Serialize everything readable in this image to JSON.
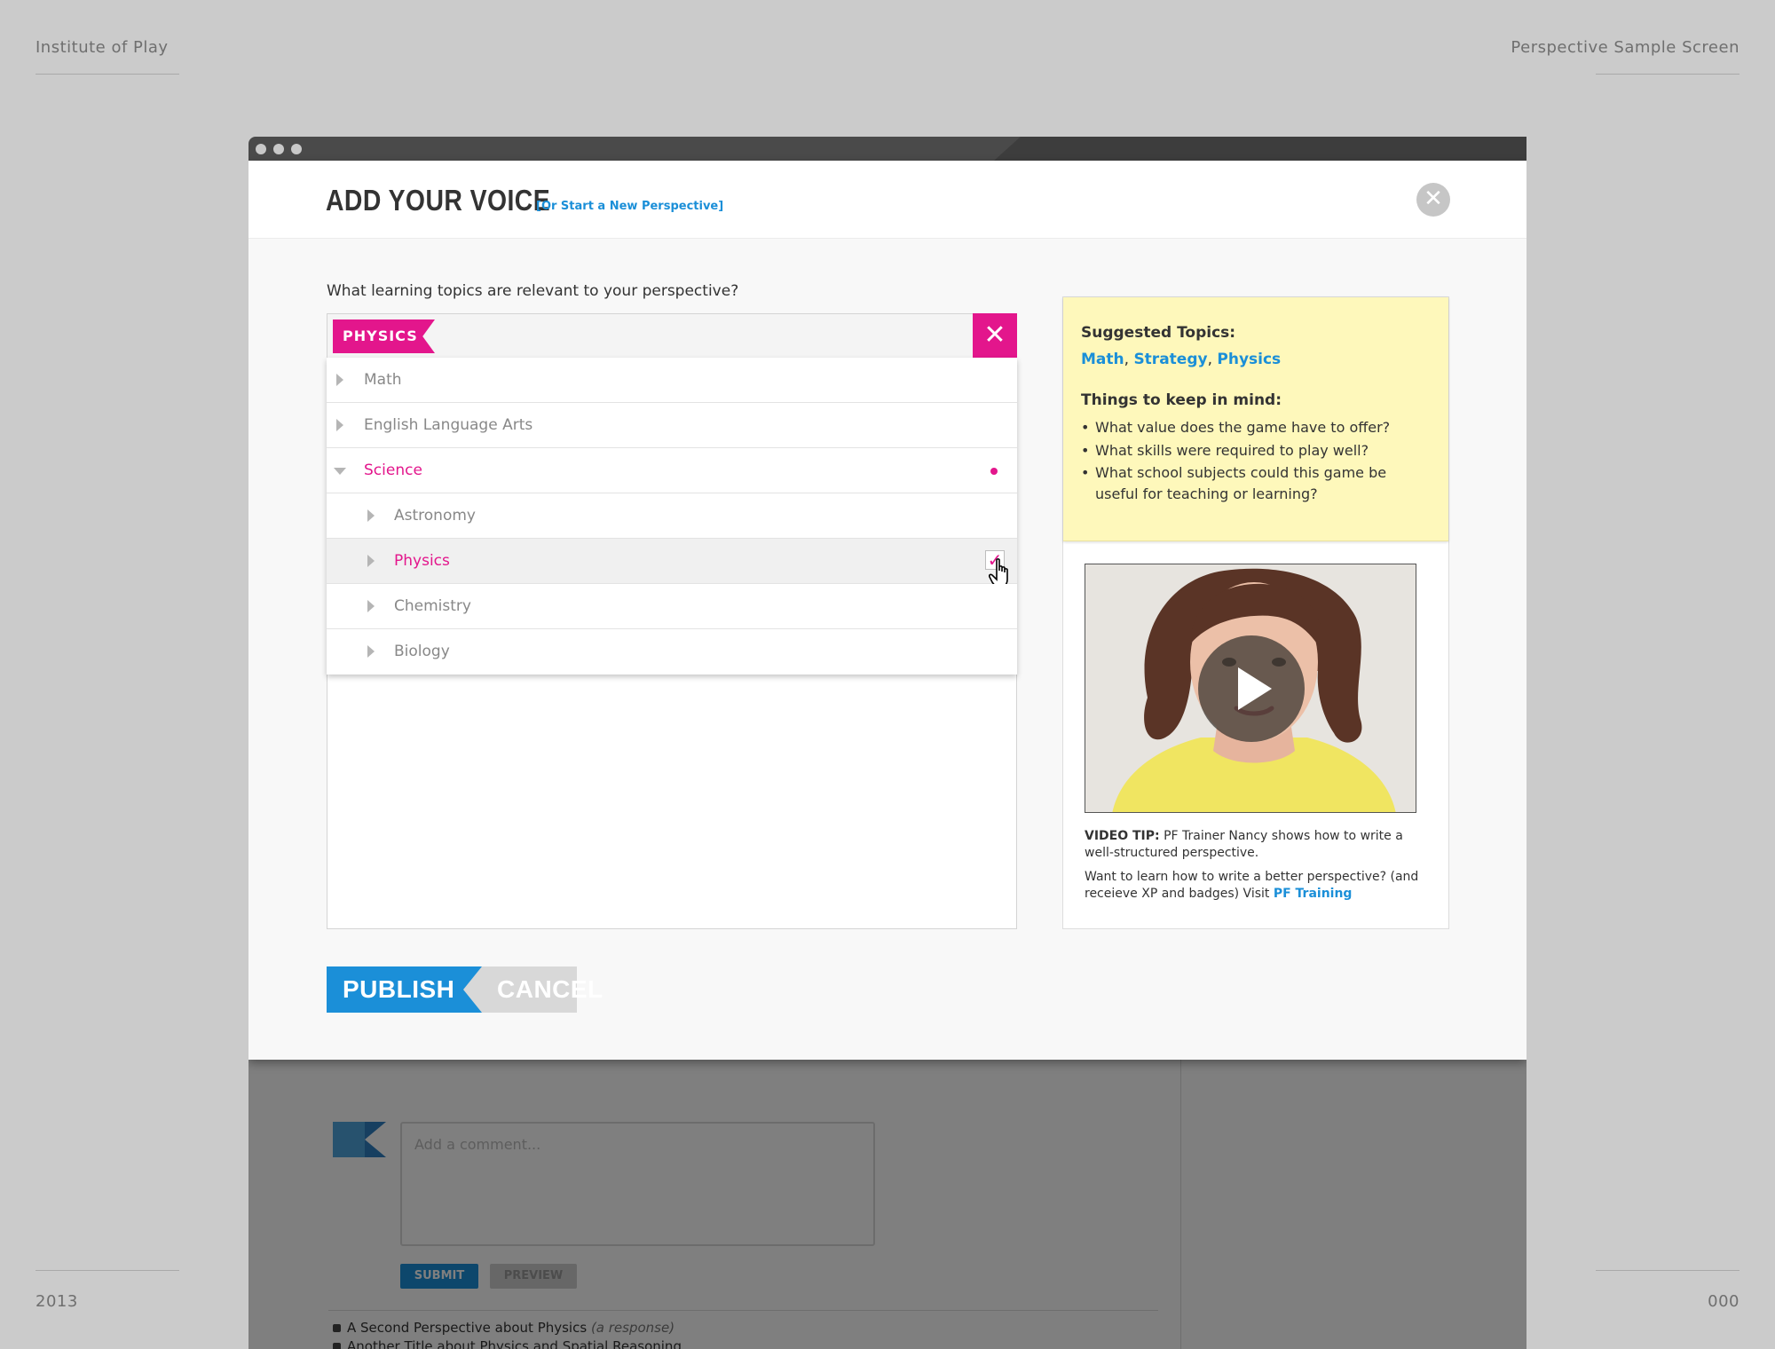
{
  "corners": {
    "top_left": "Institute of Play",
    "top_right": "Perspective Sample Screen",
    "bottom_left": "2013",
    "bottom_right": "000"
  },
  "modal": {
    "title": "ADD YOUR VOICE",
    "subtitle_link": "[Or Start a New Perspective]",
    "close_icon": "close-icon",
    "question": "What learning topics are relevant to your perspective?",
    "selected_tag": "PHYSICS",
    "topics": [
      {
        "label": "Math",
        "level": 0,
        "expanded": false
      },
      {
        "label": "English Language Arts",
        "level": 0,
        "expanded": false
      },
      {
        "label": "Science",
        "level": 0,
        "expanded": true,
        "active": true
      },
      {
        "label": "Astronomy",
        "level": 1,
        "expanded": false
      },
      {
        "label": "Physics",
        "level": 1,
        "expanded": false,
        "checked": true,
        "active": true
      },
      {
        "label": "Chemistry",
        "level": 1,
        "expanded": false
      },
      {
        "label": "Biology",
        "level": 1,
        "expanded": false
      }
    ],
    "buttons": {
      "publish": "PUBLISH",
      "cancel": "CANCEL"
    }
  },
  "tips": {
    "suggested_heading": "Suggested Topics:",
    "suggested_links": [
      "Math",
      "Strategy",
      "Physics"
    ],
    "keep_heading": "Things to keep in mind:",
    "keep_items": [
      "What value does the game have to offer?",
      "What skills were required to play well?",
      "What school subjects could this game be useful for teaching or learning?"
    ]
  },
  "video": {
    "tip_label": "VIDEO TIP:",
    "tip_text": "PF Trainer Nancy shows how to write a well-structured perspective.",
    "more_text": "Want to learn how to write a better perspective? (and receieve XP and badges) Visit",
    "more_link": "PF Training"
  },
  "background_page": {
    "comment_placeholder": "Add a comment...",
    "submit_label": "SUBMIT",
    "preview_label": "PREVIEW",
    "list": [
      {
        "title": "A Second Perspective about Physics",
        "note": "(a response)"
      },
      {
        "title": "Another Title about Physics and Spatial Reasoning",
        "note": ""
      }
    ]
  },
  "colors": {
    "accent_pink": "#e3168c",
    "accent_blue": "#1b8fd8",
    "tips_yellow": "#fef8bb"
  }
}
